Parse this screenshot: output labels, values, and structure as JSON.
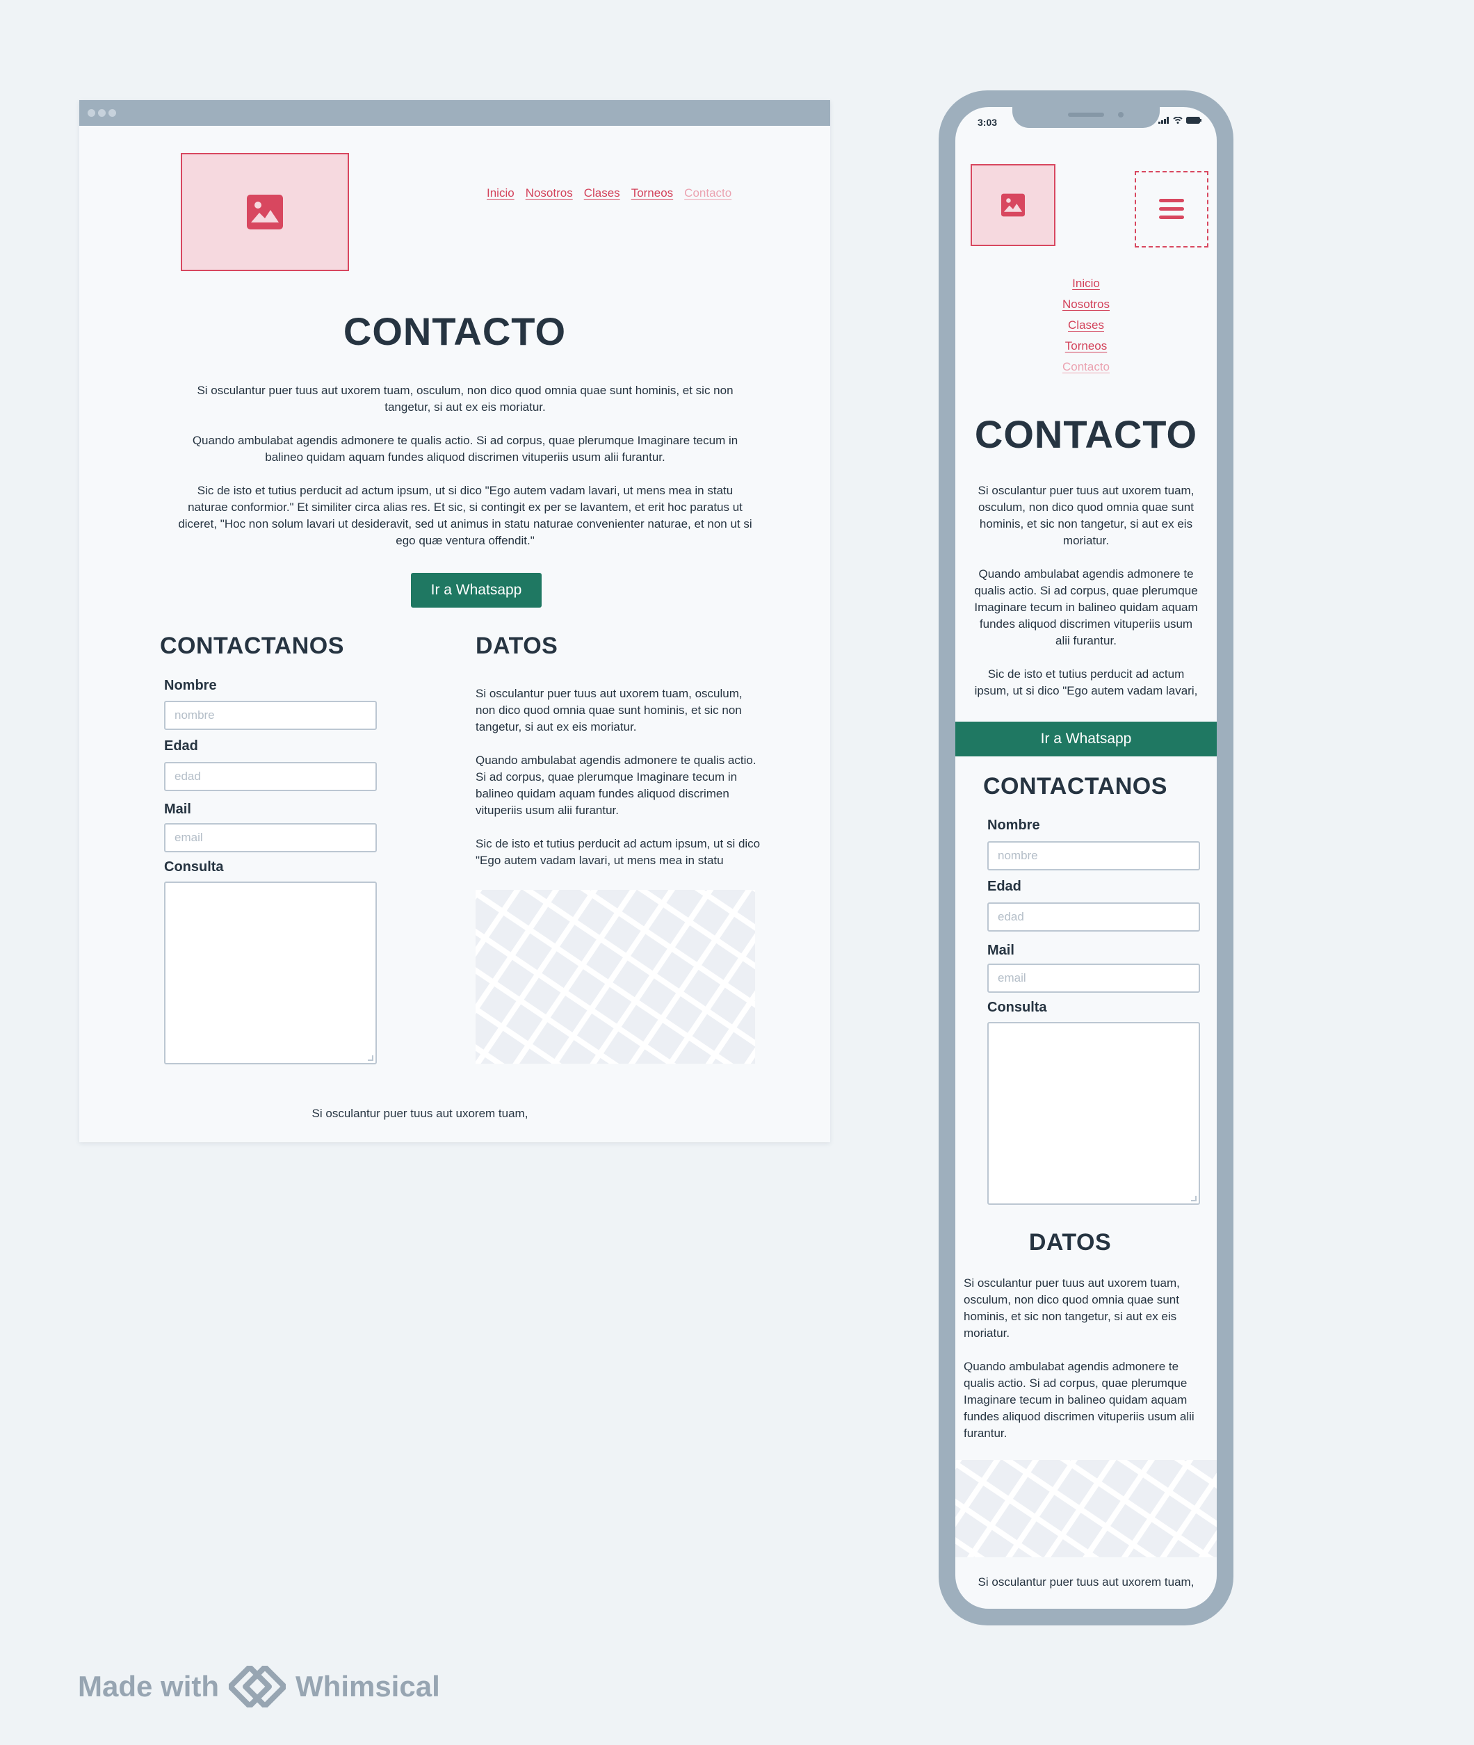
{
  "nav": {
    "items": [
      "Inicio",
      "Nosotros",
      "Clases",
      "Torneos"
    ],
    "current": "Contacto"
  },
  "page": {
    "title": "CONTACTO",
    "intro": [
      "Si osculantur puer tuus aut uxorem tuam, osculum, non dico quod omnia quae sunt hominis, et sic non tangetur, si aut ex eis moriatur.",
      "Quando ambulabat agendis admonere te qualis actio. Si ad corpus, quae plerumque Imaginare tecum in balineo quidam aquam fundes aliquod discrimen vituperiis usum alii furantur.",
      "Sic de isto et tutius perducit ad actum ipsum, ut si dico \"Ego autem vadam lavari, ut mens mea in statu naturae conformior.\" Et similiter circa alias res. Et sic, si contingit ex per se lavantem, et erit hoc paratus ut diceret, \"Hoc non solum lavari ut desideravit, sed ut animus in statu naturae convenienter naturae, et non ut si ego quæ ventura offendit.\""
    ],
    "mobile_intro_3": "Sic de isto et tutius perducit ad actum ipsum, ut si dico \"Ego autem vadam lavari,",
    "whatsapp_button": "Ir a Whatsapp",
    "footer": "Si osculantur puer tuus aut uxorem tuam,"
  },
  "form": {
    "heading": "CONTACTANOS",
    "name_label": "Nombre",
    "name_placeholder": "nombre",
    "age_label": "Edad",
    "age_placeholder": "edad",
    "mail_label": "Mail",
    "mail_placeholder": "email",
    "query_label": "Consulta"
  },
  "datos": {
    "heading": "DATOS",
    "paragraphs": [
      "Si osculantur puer tuus aut uxorem tuam, osculum, non dico quod omnia quae sunt hominis, et sic non tangetur, si aut ex eis moriatur.",
      "Quando ambulabat agendis admonere te qualis actio. Si ad corpus, quae plerumque Imaginare tecum in balineo quidam aquam fundes aliquod discrimen vituperiis usum alii furantur.",
      "Sic de isto et tutius perducit ad actum ipsum, ut si dico \"Ego autem vadam lavari, ut mens mea in statu"
    ]
  },
  "phone": {
    "status_time": "3:03"
  },
  "watermark": {
    "made_with": "Made with",
    "brand": "Whimsical"
  },
  "colors": {
    "accent": "#d8475f",
    "whatsapp": "#1f7862",
    "text": "#263441",
    "frame": "#9eafbd",
    "map": "#eceff4"
  },
  "icons": [
    "image-icon",
    "hamburger-menu-icon",
    "signal-icon",
    "wifi-icon",
    "battery-icon",
    "whimsical-logo-icon"
  ]
}
